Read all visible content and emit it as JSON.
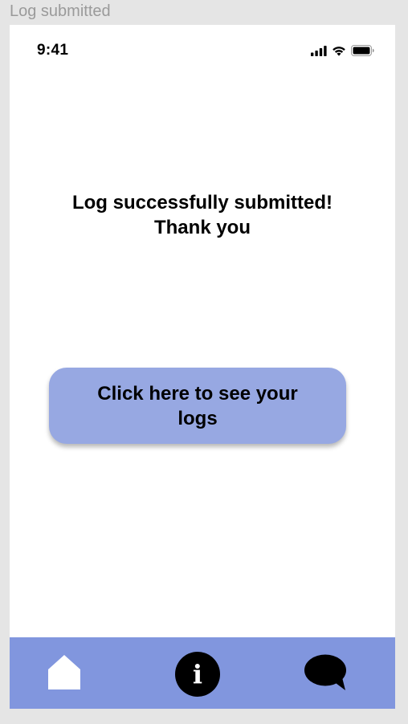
{
  "frame": {
    "label": "Log submitted"
  },
  "status_bar": {
    "time": "9:41",
    "icons": [
      "cellular-signal-icon",
      "wifi-icon",
      "battery-icon"
    ]
  },
  "message": {
    "line1": "Log successfully submitted!",
    "line2": "Thank you"
  },
  "cta": {
    "label": "Click here to see your logs"
  },
  "tab_bar": {
    "items": [
      {
        "icon": "home-icon"
      },
      {
        "icon": "info-icon",
        "glyph": "i"
      },
      {
        "icon": "chat-icon"
      }
    ]
  },
  "colors": {
    "background": "#e5e5e5",
    "screen": "#ffffff",
    "button": "#97a8e2",
    "tab_bar": "#8196de",
    "text": "#000000"
  }
}
